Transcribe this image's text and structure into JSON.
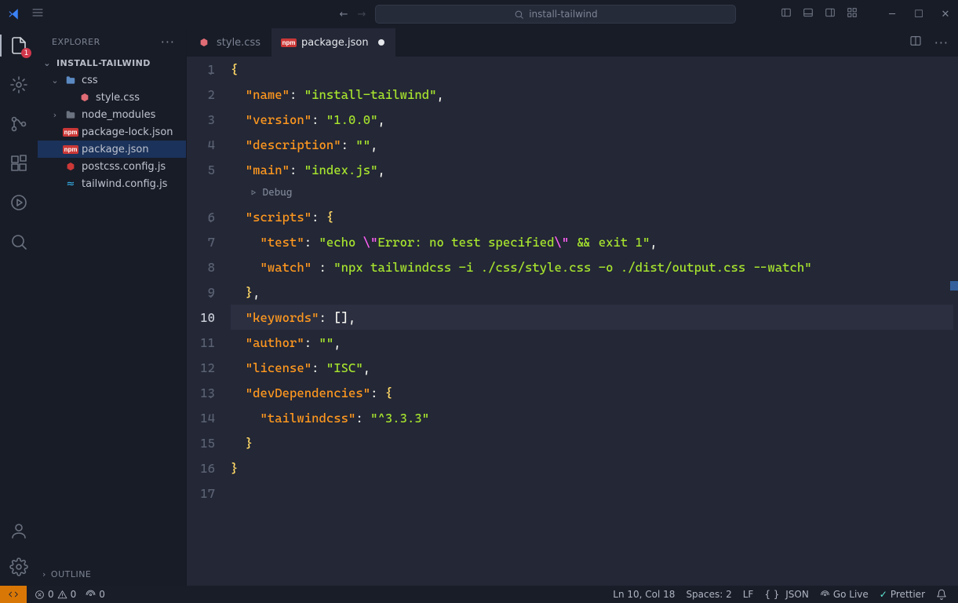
{
  "window": {
    "search_placeholder": "install-tailwind"
  },
  "explorer": {
    "title": "EXPLORER",
    "dots": "···",
    "root": "INSTALL-TAILWIND",
    "tree": [
      {
        "name": "css",
        "type": "folder",
        "depth": 1
      },
      {
        "name": "style.css",
        "type": "css",
        "depth": 2
      },
      {
        "name": "node_modules",
        "type": "folder-closed",
        "depth": 1
      },
      {
        "name": "package-lock.json",
        "type": "npm",
        "depth": 1
      },
      {
        "name": "package.json",
        "type": "npm",
        "depth": 1,
        "selected": true
      },
      {
        "name": "postcss.config.js",
        "type": "js",
        "depth": 1
      },
      {
        "name": "tailwind.config.js",
        "type": "tw",
        "depth": 1
      }
    ],
    "outline": "OUTLINE"
  },
  "activity": {
    "badge": "1"
  },
  "tabs": [
    {
      "label": "style.css",
      "type": "css",
      "active": false
    },
    {
      "label": "package.json",
      "type": "npm",
      "active": true,
      "dirty": true
    }
  ],
  "codelens": "Debug",
  "editor": {
    "cursor_line": 10,
    "content_json": {
      "name": "install-tailwind",
      "version": "1.0.0",
      "description": "",
      "main": "index.js",
      "scripts": {
        "test": "echo \"Error: no test specified\" && exit 1",
        "watch": "npx tailwindcss -i ./css/style.css -o ./dist/output.css --watch"
      },
      "keywords": [],
      "author": "",
      "license": "ISC",
      "devDependencies": {
        "tailwindcss": "^3.3.3"
      }
    },
    "lines": [
      {
        "n": 1,
        "t": [
          [
            "b",
            "{"
          ]
        ]
      },
      {
        "n": 2,
        "t": [
          [
            "p",
            "  "
          ],
          [
            "k",
            "\"name\""
          ],
          [
            "p",
            ": "
          ],
          [
            "s",
            "\"install-tailwind\""
          ],
          [
            "p",
            ","
          ]
        ]
      },
      {
        "n": 3,
        "t": [
          [
            "p",
            "  "
          ],
          [
            "k",
            "\"version\""
          ],
          [
            "p",
            ": "
          ],
          [
            "s",
            "\"1.0.0\""
          ],
          [
            "p",
            ","
          ]
        ]
      },
      {
        "n": 4,
        "t": [
          [
            "p",
            "  "
          ],
          [
            "k",
            "\"description\""
          ],
          [
            "p",
            ": "
          ],
          [
            "s",
            "\"\""
          ],
          [
            "p",
            ","
          ]
        ]
      },
      {
        "n": 5,
        "t": [
          [
            "p",
            "  "
          ],
          [
            "k",
            "\"main\""
          ],
          [
            "p",
            ": "
          ],
          [
            "s",
            "\"index.js\""
          ],
          [
            "p",
            ","
          ]
        ]
      },
      {
        "n": 6,
        "t": [
          [
            "p",
            "  "
          ],
          [
            "k",
            "\"scripts\""
          ],
          [
            "p",
            ": "
          ],
          [
            "b",
            "{"
          ]
        ]
      },
      {
        "n": 7,
        "t": [
          [
            "p",
            "    "
          ],
          [
            "k",
            "\"test\""
          ],
          [
            "p",
            ": "
          ],
          [
            "s",
            "\"echo "
          ],
          [
            "e",
            "\\\""
          ],
          [
            "s",
            "Error: no test specified"
          ],
          [
            "e",
            "\\\""
          ],
          [
            "s",
            " && exit 1\""
          ],
          [
            "p",
            ","
          ]
        ]
      },
      {
        "n": 8,
        "t": [
          [
            "p",
            "    "
          ],
          [
            "k",
            "\"watch\""
          ],
          [
            "p",
            " : "
          ],
          [
            "s",
            "\"npx tailwindcss -i ./css/style.css -o ./dist/output.css --watch\""
          ]
        ]
      },
      {
        "n": 9,
        "t": [
          [
            "p",
            "  "
          ],
          [
            "b",
            "}"
          ],
          [
            "p",
            ","
          ]
        ]
      },
      {
        "n": 10,
        "t": [
          [
            "p",
            "  "
          ],
          [
            "k",
            "\"keywords\""
          ],
          [
            "p",
            ": ["
          ],
          [
            "p",
            "]"
          ],
          [
            "p",
            ","
          ]
        ]
      },
      {
        "n": 11,
        "t": [
          [
            "p",
            "  "
          ],
          [
            "k",
            "\"author\""
          ],
          [
            "p",
            ": "
          ],
          [
            "s",
            "\"\""
          ],
          [
            "p",
            ","
          ]
        ]
      },
      {
        "n": 12,
        "t": [
          [
            "p",
            "  "
          ],
          [
            "k",
            "\"license\""
          ],
          [
            "p",
            ": "
          ],
          [
            "s",
            "\"ISC\""
          ],
          [
            "p",
            ","
          ]
        ]
      },
      {
        "n": 13,
        "t": [
          [
            "p",
            "  "
          ],
          [
            "k",
            "\"devDependencies\""
          ],
          [
            "p",
            ": "
          ],
          [
            "b",
            "{"
          ]
        ]
      },
      {
        "n": 14,
        "t": [
          [
            "p",
            "    "
          ],
          [
            "k",
            "\"tailwindcss\""
          ],
          [
            "p",
            ": "
          ],
          [
            "s",
            "\"^3.3.3\""
          ]
        ]
      },
      {
        "n": 15,
        "t": [
          [
            "p",
            "  "
          ],
          [
            "b",
            "}"
          ]
        ]
      },
      {
        "n": 16,
        "t": [
          [
            "b",
            "}"
          ]
        ]
      },
      {
        "n": 17,
        "t": []
      }
    ]
  },
  "status": {
    "errors": "0",
    "warnings": "0",
    "port": "0",
    "cursor": "Ln 10, Col 18",
    "spaces": "Spaces: 2",
    "eol": "LF",
    "lang": "JSON",
    "golive": "Go Live",
    "prettier": "Prettier"
  }
}
